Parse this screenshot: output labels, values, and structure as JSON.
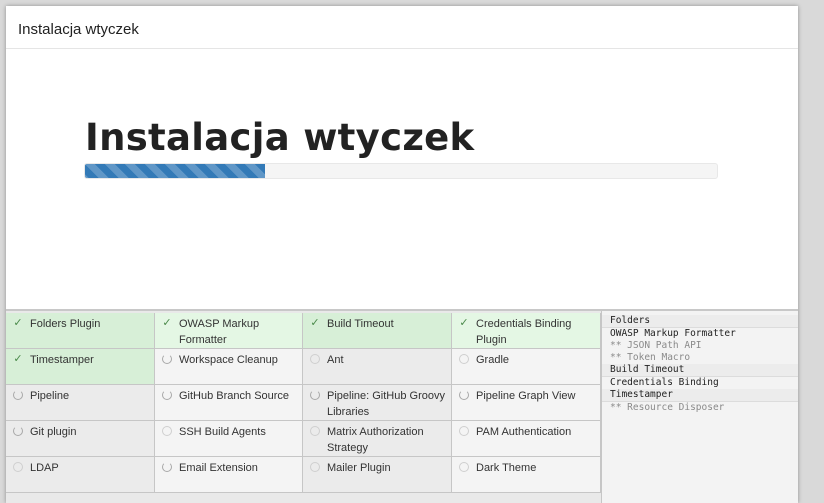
{
  "dialog": {
    "header_title": "Instalacja wtyczek",
    "main_title": "Instalacja wtyczek",
    "progress": {
      "fraction": 0.285,
      "color": "#337ab7"
    }
  },
  "plugins": [
    {
      "label": "Folders Plugin",
      "status": "done"
    },
    {
      "label": "OWASP Markup Formatter",
      "status": "done"
    },
    {
      "label": "Build Timeout",
      "status": "done"
    },
    {
      "label": "Credentials Binding Plugin",
      "status": "done"
    },
    {
      "label": "Timestamper",
      "status": "done"
    },
    {
      "label": "Workspace Cleanup",
      "status": "installing"
    },
    {
      "label": "Ant",
      "status": "pending"
    },
    {
      "label": "Gradle",
      "status": "pending"
    },
    {
      "label": "Pipeline",
      "status": "installing"
    },
    {
      "label": "GitHub Branch Source",
      "status": "installing"
    },
    {
      "label": "Pipeline: GitHub Groovy Libraries",
      "status": "installing"
    },
    {
      "label": "Pipeline Graph View",
      "status": "installing"
    },
    {
      "label": "Git plugin",
      "status": "installing"
    },
    {
      "label": "SSH Build Agents",
      "status": "pending"
    },
    {
      "label": "Matrix Authorization Strategy",
      "status": "pending"
    },
    {
      "label": "PAM Authentication",
      "status": "pending"
    },
    {
      "label": "LDAP",
      "status": "pending"
    },
    {
      "label": "Email Extension",
      "status": "installing"
    },
    {
      "label": "Mailer Plugin",
      "status": "pending"
    },
    {
      "label": "Dark Theme",
      "status": "pending"
    }
  ],
  "log": [
    {
      "text": "Folders",
      "dep": false
    },
    {
      "text": "OWASP Markup Formatter",
      "dep": false
    },
    {
      "text": "** JSON Path API",
      "dep": true
    },
    {
      "text": "** Token Macro",
      "dep": true
    },
    {
      "text": "Build Timeout",
      "dep": false
    },
    {
      "text": "Credentials Binding",
      "dep": false
    },
    {
      "text": "Timestamper",
      "dep": false
    },
    {
      "text": "** Resource Disposer",
      "dep": true
    }
  ],
  "colors": {
    "done_bg": "#d7efd7",
    "pending_bg": "#ebebeb",
    "check": "#4a8a4a"
  },
  "icons": {
    "done": "check-icon",
    "installing": "spinner-icon",
    "pending": "circle-icon"
  }
}
